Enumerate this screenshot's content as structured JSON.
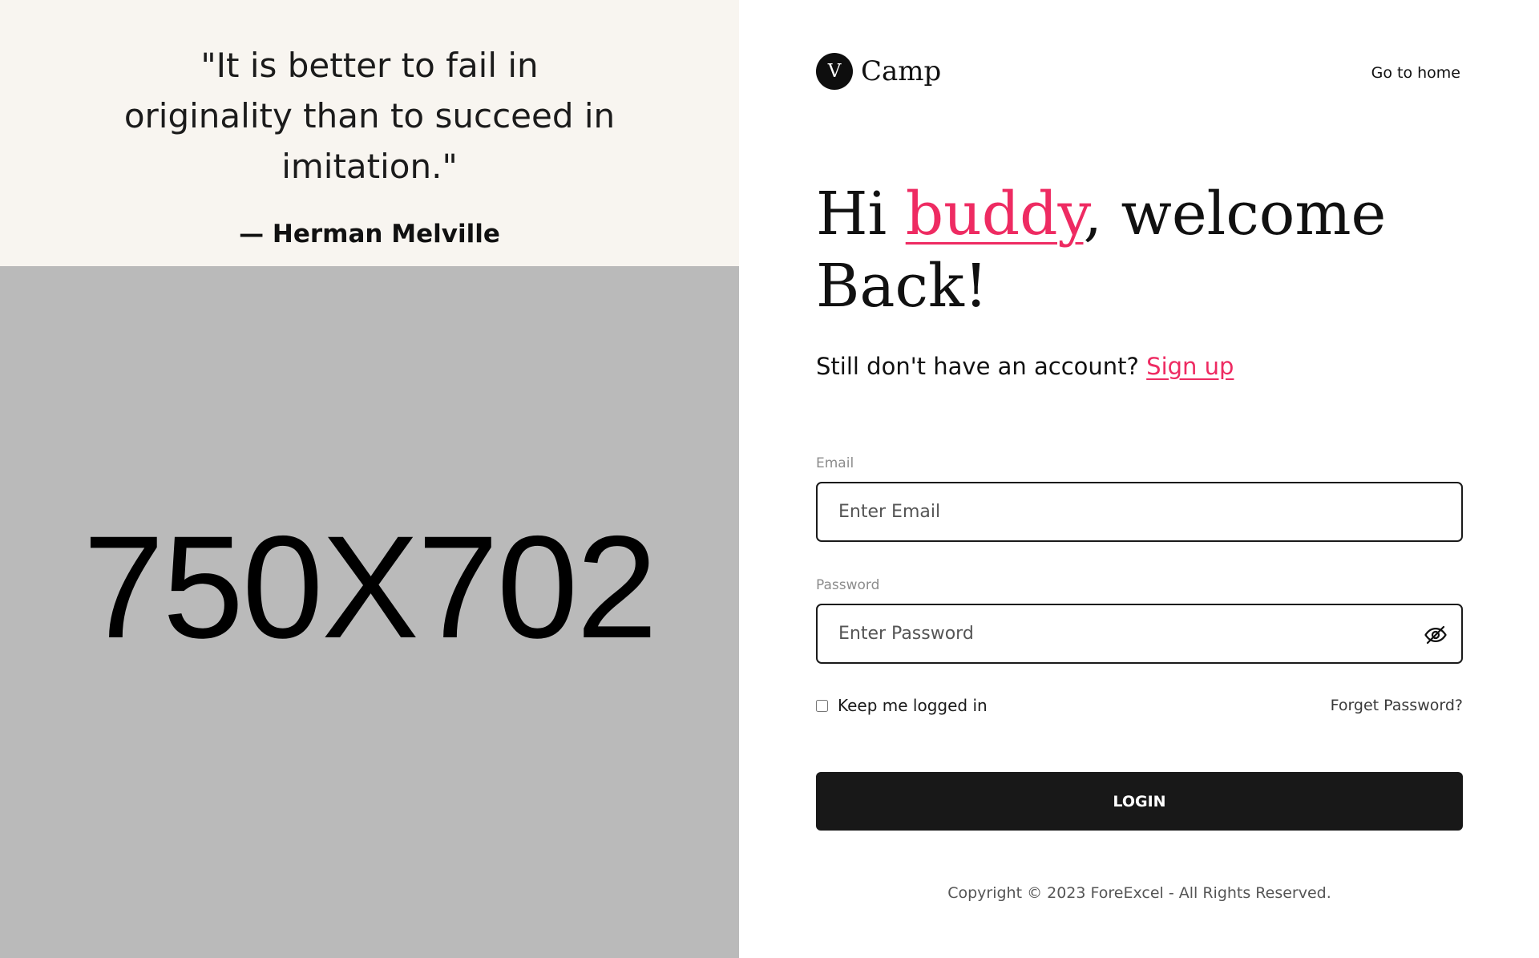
{
  "quote": {
    "text": "\"It is better to fail in originality than to succeed in imitation.\"",
    "author": "— Herman Melville"
  },
  "placeholder_image": {
    "label": "750X702"
  },
  "header": {
    "logo_mark": "V",
    "logo_text": "Camp",
    "go_home_label": "Go to home"
  },
  "welcome": {
    "greeting_prefix": "Hi ",
    "greeting_accent": "buddy",
    "greeting_suffix": ", welcome Back!",
    "signup_prompt": "Still don't have an account? ",
    "signup_link": "Sign up"
  },
  "form": {
    "email_label": "Email",
    "email_placeholder": "Enter Email",
    "email_value": "",
    "password_label": "Password",
    "password_placeholder": "Enter Password",
    "password_value": "",
    "password_toggle_icon": "eye-slash-icon",
    "remember_label": "Keep me logged in",
    "remember_checked": false,
    "forgot_label": "Forget Password?",
    "login_label": "LOGIN"
  },
  "footer": {
    "copyright": "Copyright © 2023 ForeExcel - All Rights Reserved."
  },
  "colors": {
    "accent": "#ee2b62",
    "quote_background": "#f8f5f0",
    "placeholder_background": "#bababa",
    "button_background": "#181818"
  }
}
